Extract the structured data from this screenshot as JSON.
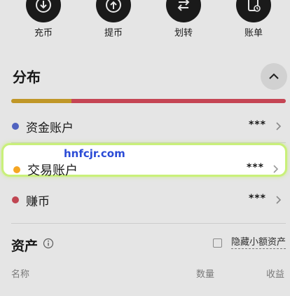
{
  "actions": [
    {
      "label": "充币",
      "icon": "download-icon"
    },
    {
      "label": "提币",
      "icon": "upload-icon"
    },
    {
      "label": "划转",
      "icon": "transfer-icon"
    },
    {
      "label": "账单",
      "icon": "bill-icon"
    }
  ],
  "distribution": {
    "title": "分布",
    "bar": [
      {
        "color": "#d6a92c",
        "fraction": 0.22
      },
      {
        "color": "#dc4d5e",
        "fraction": 0.78
      }
    ],
    "accounts": [
      {
        "name": "资金账户",
        "value": "***",
        "dot_color": "#5b6fd6"
      },
      {
        "name": "交易账户",
        "value": "***",
        "dot_color": "#f5a623"
      },
      {
        "name": "赚币",
        "value": "***",
        "dot_color": "#d64f5c"
      }
    ]
  },
  "watermark": "hnfcjr.com",
  "assets": {
    "title": "资产",
    "hide_small_label": "隐藏小额资产",
    "hide_small_checked": false,
    "columns": [
      "名称",
      "数量",
      "收益"
    ]
  }
}
